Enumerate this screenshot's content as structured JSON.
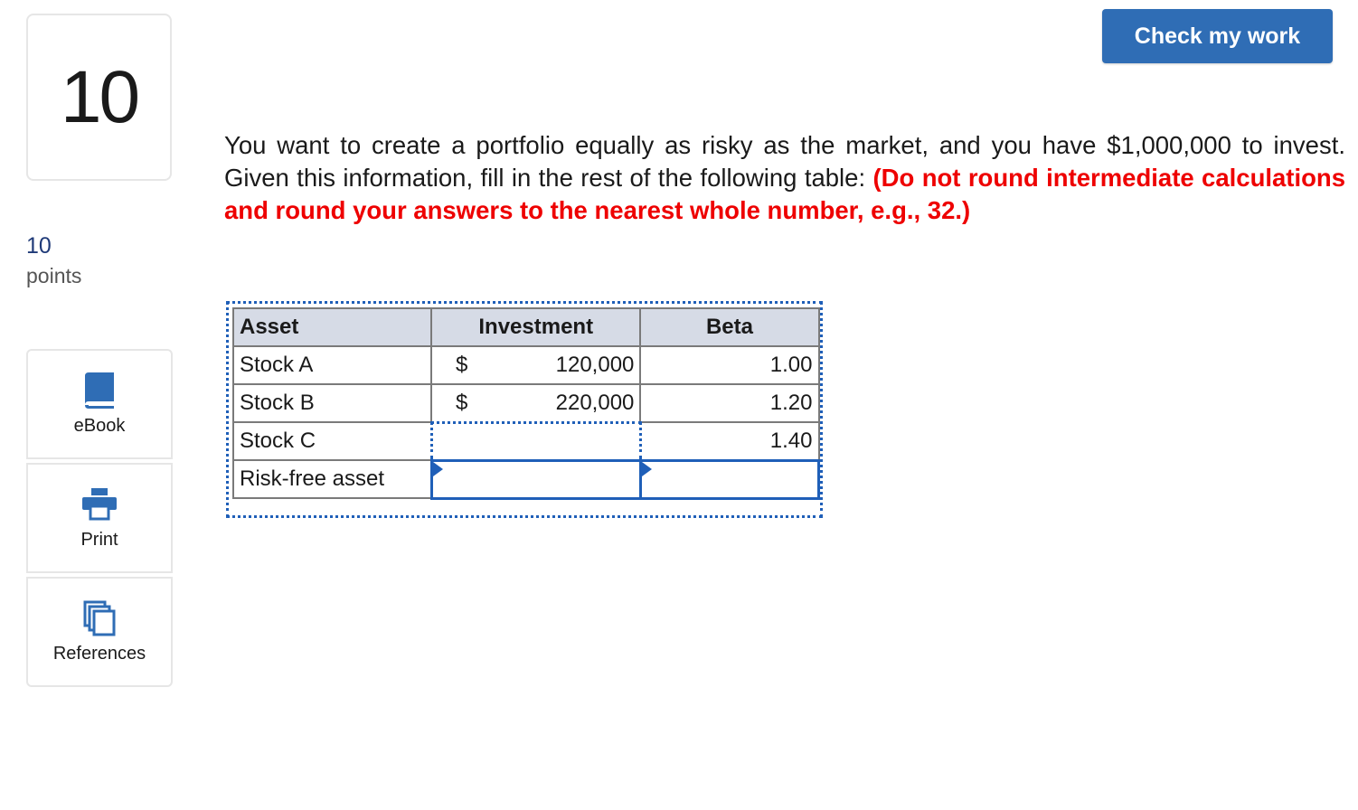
{
  "question": {
    "number": "10",
    "points_value": "10",
    "points_label": "points",
    "prompt": "You want to create a portfolio equally as risky as the market, and you have $1,000,000 to invest. Given this information, fill in the rest of the following table: ",
    "instructions": "(Do not round intermediate calculations and round your answers to the nearest whole number, e.g., 32.)"
  },
  "toolbar": {
    "check_label": "Check my work",
    "ebook_label": "eBook",
    "print_label": "Print",
    "references_label": "References"
  },
  "table": {
    "headers": [
      "Asset",
      "Investment",
      "Beta"
    ],
    "rows": [
      {
        "asset": "Stock A",
        "currency": "$",
        "investment": "120,000",
        "beta": "1.00"
      },
      {
        "asset": "Stock B",
        "currency": "$",
        "investment": "220,000",
        "beta": "1.20"
      },
      {
        "asset": "Stock C",
        "currency": "",
        "investment": "",
        "beta": "1.40"
      },
      {
        "asset": "Risk-free asset",
        "currency": "",
        "investment": "",
        "beta": ""
      }
    ]
  },
  "colors": {
    "accent": "#2f6db5",
    "instruction_red": "#ee0000",
    "header_bg": "#d6dbe6",
    "input_border": "#1f5fb8"
  }
}
